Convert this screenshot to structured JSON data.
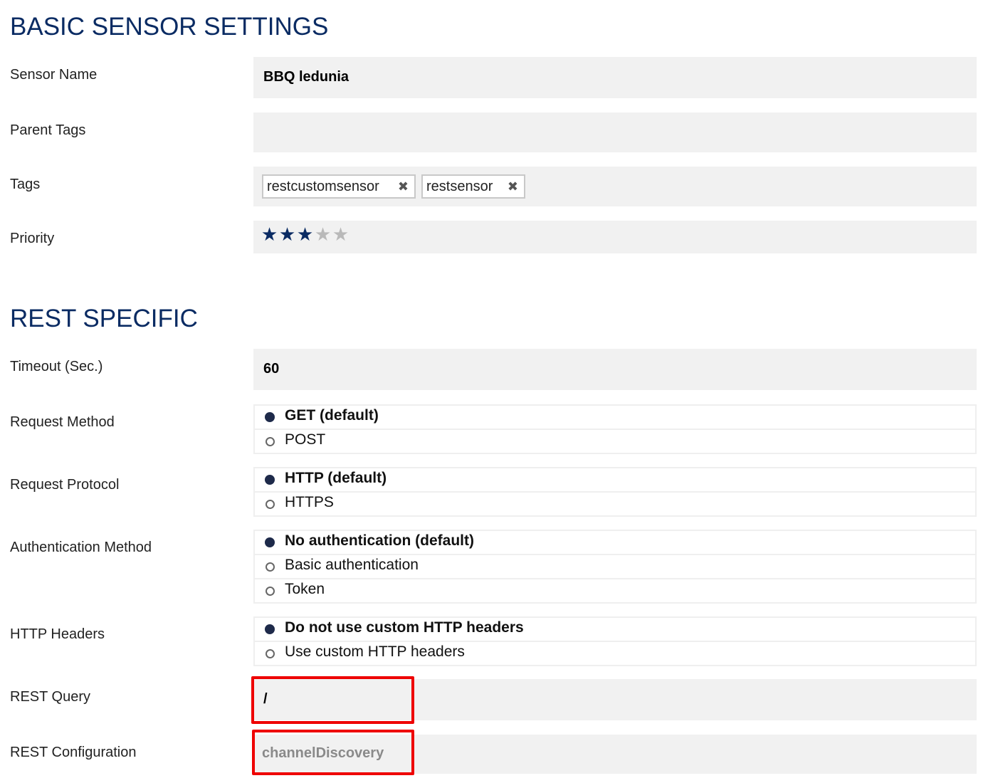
{
  "basic": {
    "title": "BASIC SENSOR SETTINGS",
    "sensor_name": {
      "label": "Sensor Name",
      "value": "BBQ ledunia"
    },
    "parent_tags": {
      "label": "Parent Tags",
      "value": ""
    },
    "tags": {
      "label": "Tags",
      "items": [
        "restcustomsensor",
        "restsensor"
      ],
      "remove_glyph": "✖"
    },
    "priority": {
      "label": "Priority",
      "value": 3,
      "max": 5,
      "glyph": "★"
    }
  },
  "rest": {
    "title": "REST SPECIFIC",
    "timeout": {
      "label": "Timeout (Sec.)",
      "value": "60"
    },
    "request_method": {
      "label": "Request Method",
      "options": [
        "GET (default)",
        "POST"
      ],
      "selected": 0
    },
    "request_protocol": {
      "label": "Request Protocol",
      "options": [
        "HTTP (default)",
        "HTTPS"
      ],
      "selected": 0
    },
    "auth_method": {
      "label": "Authentication Method",
      "options": [
        "No authentication (default)",
        "Basic authentication",
        "Token"
      ],
      "selected": 0
    },
    "http_headers": {
      "label": "HTTP Headers",
      "options": [
        "Do not use custom HTTP headers",
        "Use custom HTTP headers"
      ],
      "selected": 0
    },
    "rest_query": {
      "label": "REST Query",
      "value": "/"
    },
    "rest_config": {
      "label": "REST Configuration",
      "value": "channelDiscovery"
    }
  },
  "colors": {
    "heading": "#0a2b63",
    "field_bg": "#f1f1f1",
    "highlight": "#ee0000",
    "star_on": "#0a2b63",
    "star_off": "#b9b9b9"
  }
}
